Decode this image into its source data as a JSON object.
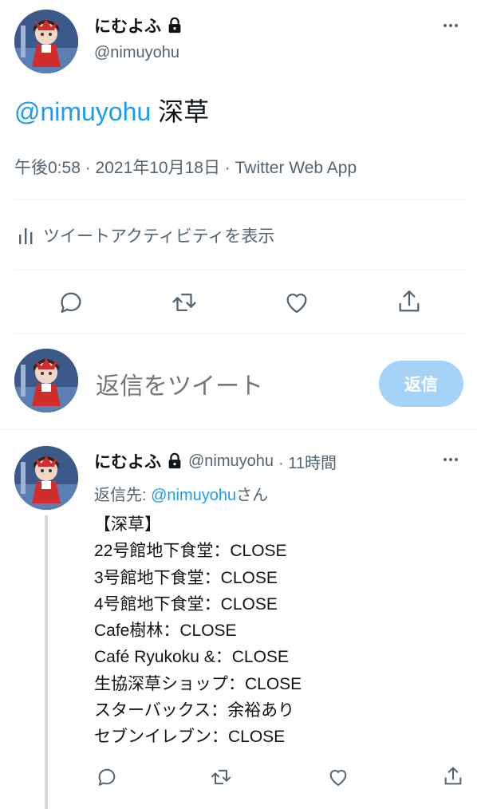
{
  "main_tweet": {
    "author_name": "にむよふ",
    "author_handle": "@nimuyohu",
    "text_mention": "@nimuyohu",
    "text_body": " 深草",
    "meta": "午後0:58 · 2021年10月18日 · Twitter Web App"
  },
  "activity": {
    "label": "ツイートアクティビティを表示"
  },
  "actions": [
    "reply",
    "retweet",
    "like",
    "share"
  ],
  "compose": {
    "placeholder": "返信をツイート",
    "button_label": "返信"
  },
  "reply_tweet": {
    "author_name": "にむよふ",
    "author_handle": "@nimuyohu",
    "time": "· 11時間",
    "reply_to_prefix": "返信先: ",
    "reply_to_handle": "@nimuyohu",
    "reply_to_suffix": "さん",
    "lines": [
      "【深草】",
      "22号館地下食堂：CLOSE",
      "3号館地下食堂：CLOSE",
      "4号館地下食堂：CLOSE",
      "Cafe樹林：CLOSE",
      "Café Ryukoku &：CLOSE",
      "生協深草ショップ：CLOSE",
      "スターバックス：余裕あり",
      "セブンイレブン：CLOSE"
    ]
  },
  "colors": {
    "accent": "#1d9bf0",
    "accent_disabled": "#a5d3f8",
    "secondary_text": "#536471",
    "divider": "#eff3f4"
  },
  "icons": [
    "lock-icon",
    "more-icon",
    "chart-icon",
    "reply-icon",
    "retweet-icon",
    "like-icon",
    "share-icon"
  ]
}
